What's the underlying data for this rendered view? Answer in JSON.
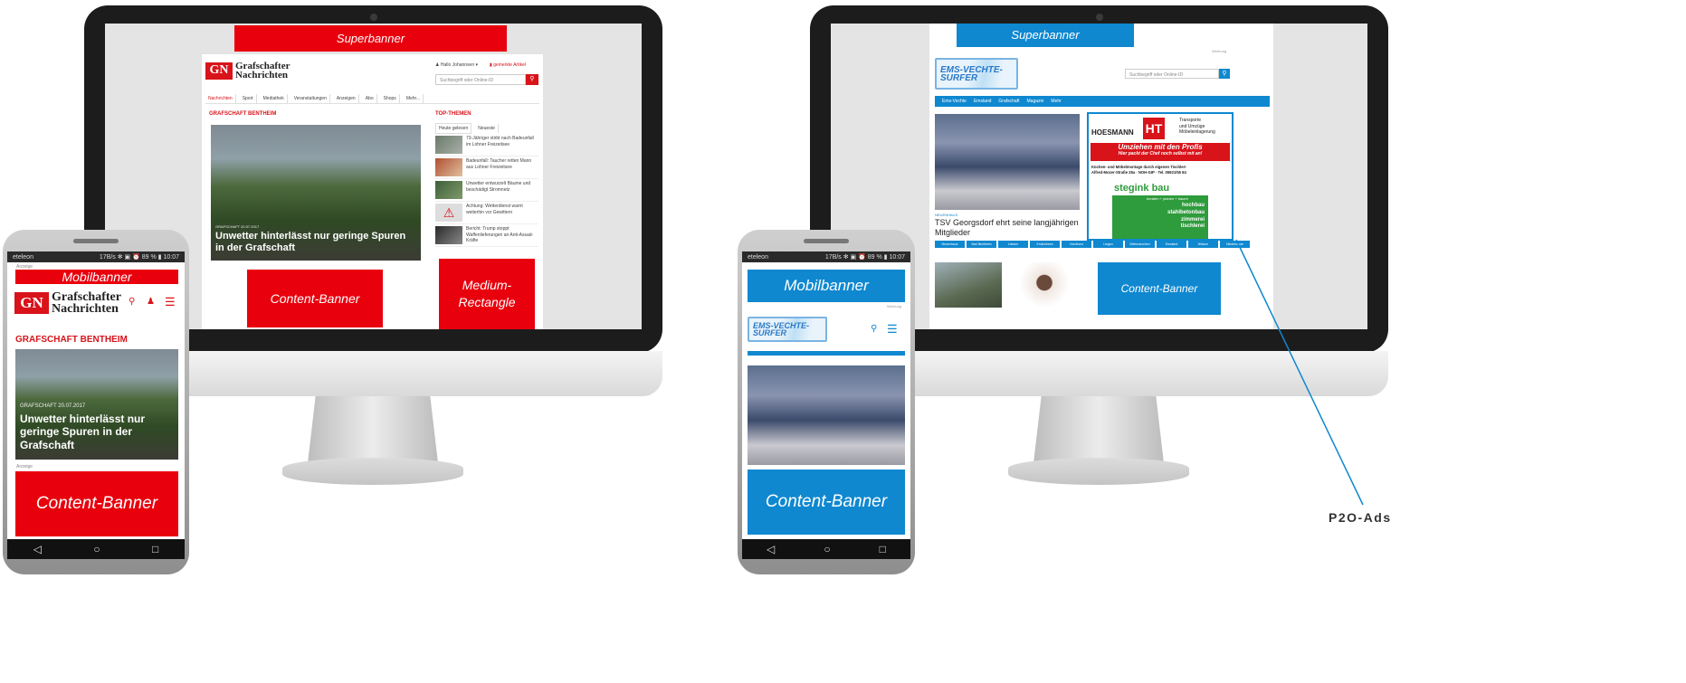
{
  "left_desktop": {
    "superbanner": "Superbanner",
    "logo_line1": "Grafschafter",
    "logo_line2": "Nachrichten",
    "logo_abbr": "GN",
    "search_placeholder": "Suchbegriff oder Online-ID",
    "account_label": "Hallo Johannsen",
    "saved_label": "gemerkte Artikel",
    "nav_items": [
      "Nachrichten",
      "Sport",
      "Mediathek",
      "Veranstaltungen",
      "Anzeigen",
      "Abo",
      "Shops",
      "Mehr..."
    ],
    "section_title": "GRAFSCHAFT BENTHEIM",
    "hero_kicker": "GRAFSCHAFT 20.07.2017",
    "hero_title": "Unwetter hinterlässt nur geringe Spuren in der Grafschaft",
    "top_themen": "TOP-THEMEN",
    "top_tabs": [
      "Heute gelesen",
      "Neueste"
    ],
    "top_items": [
      "73-Jähriger stirbt nach Badeunfall im Lohner Freizeitsee",
      "Badeunfall: Taucher retten Mann aus Lohner Freizeitsee",
      "Unwetter entwurzelt Bäume und beschädigt Stromnetz",
      "Achtung: Wetterdienst warnt weiterhin vor Gewittern",
      "Bericht: Trump stoppt Waffenlieferungen an Anti-Assad-Kräfte"
    ],
    "content_banner": "Content-Banner",
    "medium_rectangle": "Medium-Rectangle"
  },
  "left_phone": {
    "carrier": "eteleon",
    "status_right": "17B/s ✻ ▣ ⏰ 89 % ▮ 10:07",
    "ad_label": "Anzeige",
    "mobilbanner": "Mobilbanner",
    "logo_line1": "Grafschafter",
    "logo_line2": "Nachrichten",
    "logo_abbr": "GN",
    "section_title": "GRAFSCHAFT BENTHEIM",
    "hero_kicker": "GRAFSCHAFT 20.07.2017",
    "hero_title": "Unwetter hinterlässt nur geringe Spuren in der Grafschaft",
    "ad_label2": "Anzeige",
    "content_banner": "Content-Banner",
    "keys": [
      "◁",
      "○",
      "□"
    ]
  },
  "right_desktop": {
    "superbanner": "Superbanner",
    "ad_label": "Werbung",
    "logo_line1": "EMS-VECHTE-",
    "logo_line2": "SURFER",
    "search_placeholder": "Suchbegriff oder Online-ID",
    "nav_items": [
      "Ems-Vechte",
      "Emsland",
      "Grafschaft",
      "Magazin",
      "Mehr"
    ],
    "article_kicker": "NEUENHAUS",
    "article_title": "TSV Georgsdorf ehrt seine langjährigen Mitglieder",
    "ad_hoesmann_name": "HOESMANN",
    "ad_hoesmann_tag1": "Transporte",
    "ad_hoesmann_tag2": "und Umzüge",
    "ad_hoesmann_tag3": "Möbeleinlagerung",
    "ad_hoesmann_slogan1": "Umziehen mit den Profis",
    "ad_hoesmann_slogan2": "Hier packt der Chef noch selbst mit an!",
    "ad_hoesmann_info1": "Küchen- und Möbelmontage durch eigenen Tischler!",
    "ad_hoesmann_info2": "Alfred-Mozer-Straße 28a · NOH-GIP · Tel. 05921/55 84",
    "ad_stegink_name": "stegink bau",
    "ad_stegink_tag": "beraten + planen + bauen",
    "ad_stegink_lines": [
      "hochbau",
      "stahlbetonbau",
      "zimmerei",
      "tischlerei"
    ],
    "tags": [
      "Neuenhaus",
      "Bad Bentheim",
      "Uelsen",
      "Emlichheim",
      "Nordhorn",
      "Lingen",
      "Wietmarschen",
      "Emsland",
      "Wilsum",
      "Niederlande"
    ],
    "content_banner": "Content-Banner"
  },
  "right_phone": {
    "carrier": "eteleon",
    "status_right": "17B/s ✻ ▣ ⏰ 89 % ▮ 10:07",
    "mobilbanner": "Mobilbanner",
    "ad_label": "Werbung",
    "logo_line1": "EMS-VECHTE-",
    "logo_line2": "SURFER",
    "content_banner": "Content-Banner",
    "keys": [
      "◁",
      "○",
      "□"
    ]
  },
  "callout": {
    "label": "P2O-Ads"
  },
  "colors": {
    "red_ad": "#e8000d",
    "blue_ad": "#0f88d0",
    "gn_red": "#d8131a",
    "evs_blue": "#2a79c8"
  }
}
